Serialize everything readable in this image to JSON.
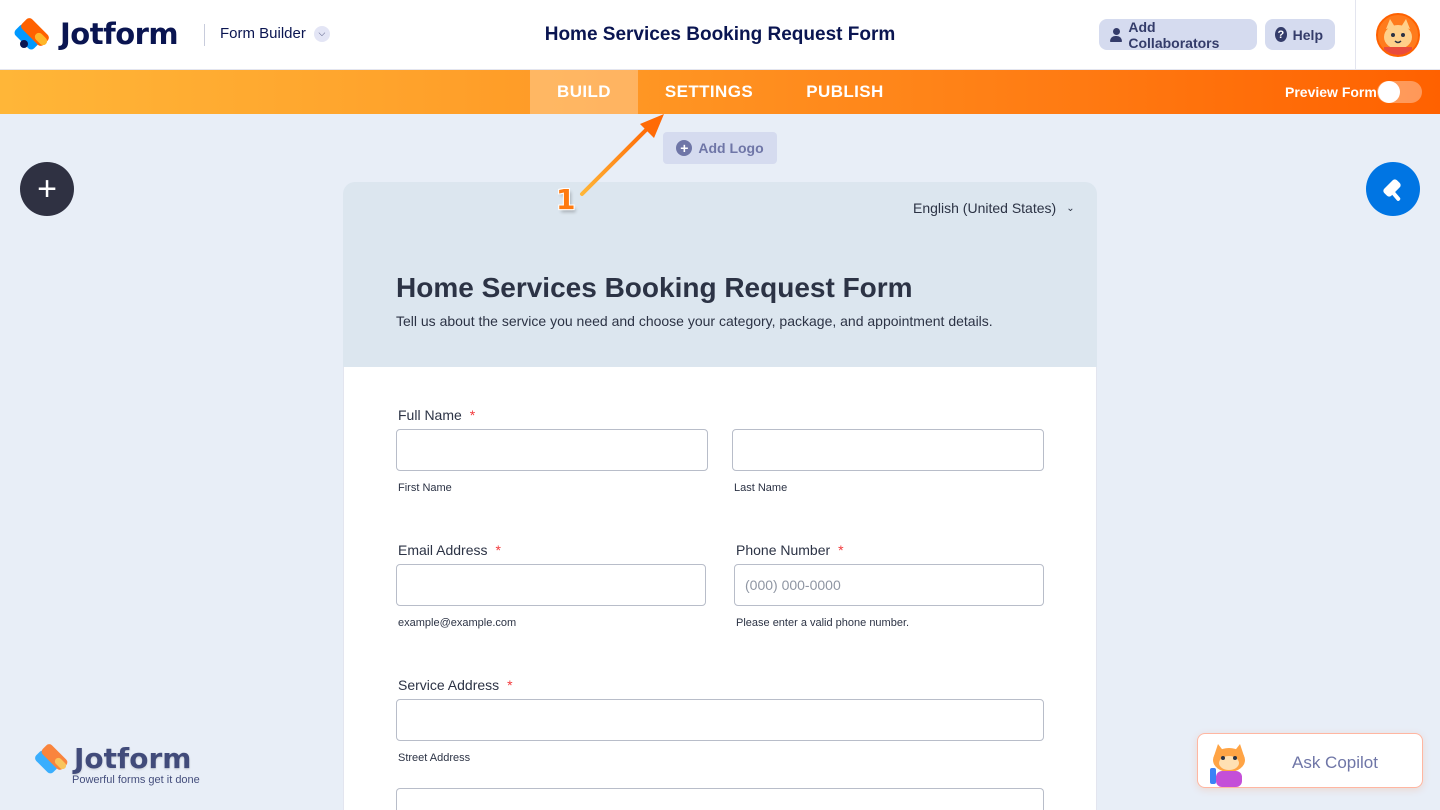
{
  "header": {
    "brand": "Jotform",
    "builder_menu": "Form Builder",
    "form_title": "Home Services Booking Request Form",
    "collaborators_button": "Add Collaborators",
    "help_button": "Help"
  },
  "nav": {
    "tabs": [
      {
        "label": "BUILD",
        "active": true
      },
      {
        "label": "SETTINGS",
        "active": false
      },
      {
        "label": "PUBLISH",
        "active": false
      }
    ],
    "preview_label": "Preview Form",
    "preview_enabled": false
  },
  "canvas": {
    "add_logo": "Add Logo",
    "annotation_step": "1"
  },
  "form": {
    "language": "English (United States)",
    "title": "Home Services Booking Request Form",
    "subtitle": "Tell us about the service you need and choose your category, package, and appointment details.",
    "fields": {
      "full_name": {
        "label": "Full Name",
        "required": "*",
        "first_sublabel": "First Name",
        "last_sublabel": "Last Name",
        "first_value": "",
        "last_value": ""
      },
      "email": {
        "label": "Email Address",
        "required": "*",
        "sublabel": "example@example.com",
        "value": ""
      },
      "phone": {
        "label": "Phone Number",
        "required": "*",
        "placeholder": "(000) 000-0000",
        "sublabel": "Please enter a valid phone number.",
        "value": ""
      },
      "address": {
        "label": "Service Address",
        "required": "*",
        "sublabel": "Street Address",
        "value": ""
      }
    }
  },
  "watermark": {
    "brand": "Jotform",
    "tagline": "Powerful forms get it done"
  },
  "copilot": {
    "label": "Ask Copilot"
  },
  "colors": {
    "brand_orange": "#ff6100",
    "brand_navy": "#0a1551",
    "accent_blue": "#0075e3",
    "required_red": "#f23a3c"
  }
}
